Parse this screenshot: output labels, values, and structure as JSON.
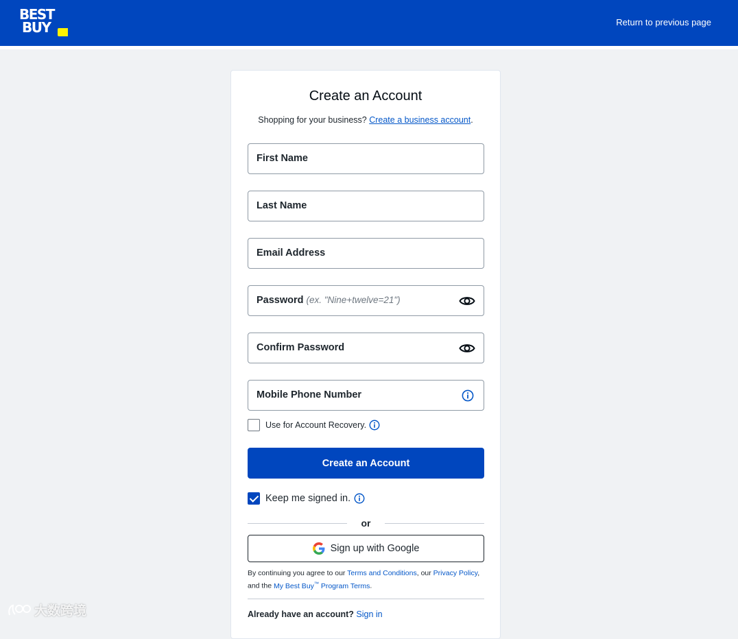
{
  "header": {
    "logo": {
      "line1": "BEST",
      "line2": "BUY"
    },
    "return_link": "Return to previous page",
    "brand_color": "#0046be",
    "tag_color": "#fff200"
  },
  "form": {
    "title": "Create an Account",
    "subtitle_prefix": "Shopping for your business?",
    "business_link": "Create a business account",
    "subtitle_suffix": ".",
    "fields": {
      "first_name": "First Name",
      "last_name": "Last Name",
      "email": "Email Address",
      "password": "Password",
      "password_hint": "(ex. \"Nine+twelve=21\")",
      "confirm_password": "Confirm Password",
      "phone": "Mobile Phone Number"
    },
    "recovery_label": "Use for Account Recovery.",
    "recovery_checked": false,
    "submit_label": "Create an Account",
    "keep_signed_in_label": "Keep me signed in.",
    "keep_signed_in_checked": true,
    "or_label": "or",
    "google_label": "Sign up with Google",
    "legal": {
      "part1": "By continuing you agree to our",
      "terms_link": "Terms and Conditions",
      "part2": ", our",
      "privacy_link": "Privacy Policy",
      "part3": ", and the",
      "program_link_a": "My Best Buy",
      "program_tm": "™",
      "program_link_b": "Program Terms",
      "part4": "."
    },
    "signin_prompt": "Already have an account?",
    "signin_link": "Sign in"
  },
  "watermark": {
    "text": "大数跨境"
  }
}
